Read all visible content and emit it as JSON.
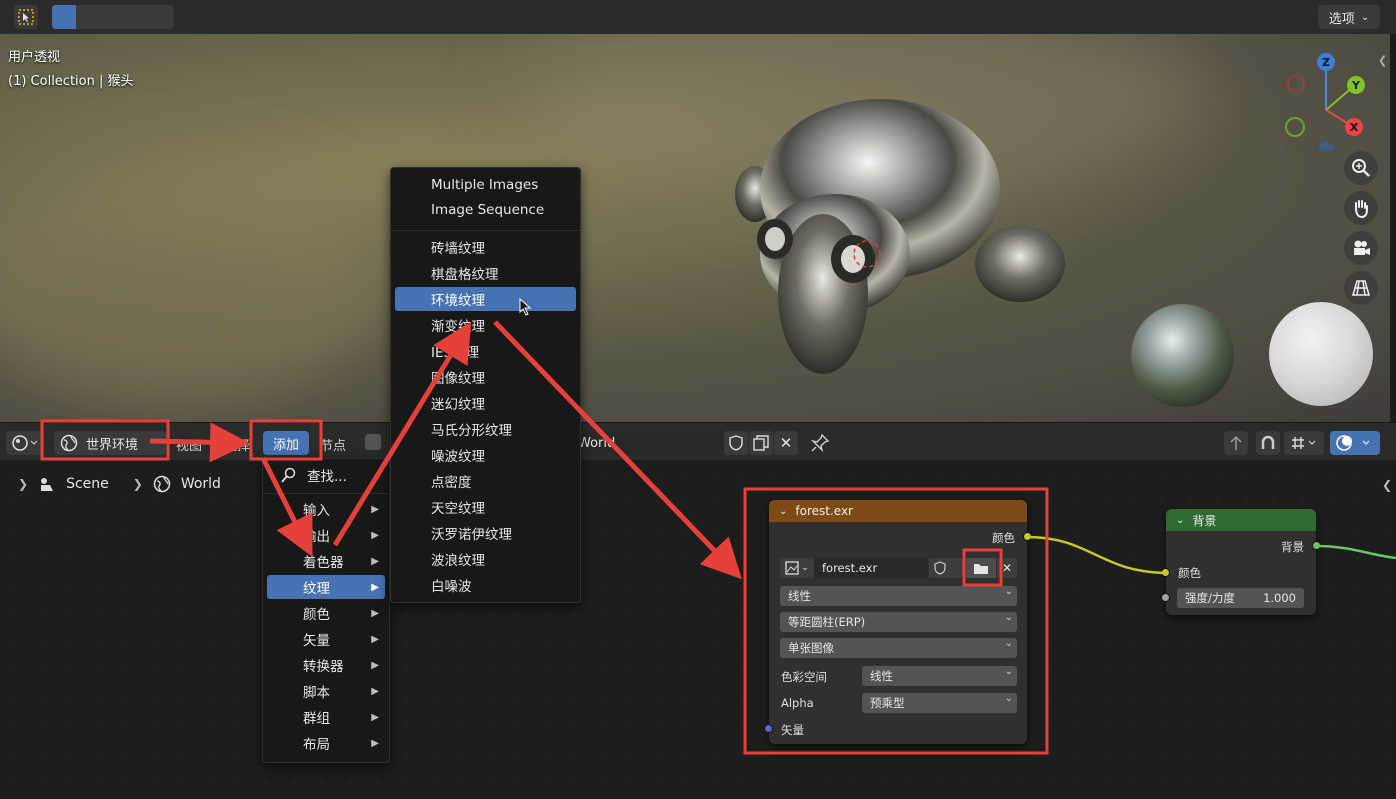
{
  "viewport": {
    "view_name": "用户透视",
    "collection_info": "(1) Collection | 猴头",
    "options_label": "选项",
    "gizmo_axes": {
      "z": "Z",
      "y": "Y",
      "x": "X"
    }
  },
  "node_header": {
    "world_type": "世界环境",
    "view_menu": "视图",
    "select_menu": "选择",
    "add_menu": "添加",
    "node_menu": "节点",
    "world_name": "World"
  },
  "breadcrumb": {
    "scene": "Scene",
    "world": "World"
  },
  "add_menu": {
    "search": "查找...",
    "items": [
      {
        "label": "输入",
        "has_submenu": true
      },
      {
        "label": "输出",
        "has_submenu": true
      },
      {
        "label": "着色器",
        "has_submenu": true
      },
      {
        "label": "纹理",
        "has_submenu": true,
        "active": true
      },
      {
        "label": "颜色",
        "has_submenu": true
      },
      {
        "label": "矢量",
        "has_submenu": true
      },
      {
        "label": "转换器",
        "has_submenu": true
      },
      {
        "label": "脚本",
        "has_submenu": true
      },
      {
        "label": "群组",
        "has_submenu": true
      },
      {
        "label": "布局",
        "has_submenu": true
      }
    ]
  },
  "texture_menu": {
    "top_items": [
      "Multiple Images",
      "Image Sequence"
    ],
    "items": [
      {
        "label": "砖墙纹理"
      },
      {
        "label": "棋盘格纹理"
      },
      {
        "label": "环境纹理",
        "active": true
      },
      {
        "label": "渐变纹理"
      },
      {
        "label": "IES纹理"
      },
      {
        "label": "图像纹理"
      },
      {
        "label": "迷幻纹理"
      },
      {
        "label": "马氏分形纹理"
      },
      {
        "label": "噪波纹理"
      },
      {
        "label": "点密度"
      },
      {
        "label": "天空纹理"
      },
      {
        "label": "沃罗诺伊纹理"
      },
      {
        "label": "波浪纹理"
      },
      {
        "label": "白噪波"
      }
    ]
  },
  "env_node": {
    "title": "forest.exr",
    "color_output": "颜色",
    "image_name": "forest.exr",
    "interpolation": "线性",
    "projection": "等距圆柱(ERP)",
    "source": "单张图像",
    "colorspace_label": "色彩空间",
    "colorspace_value": "线性",
    "alpha_label": "Alpha",
    "alpha_value": "预乘型",
    "vector_input": "矢量"
  },
  "bg_node": {
    "title": "背景",
    "output": "背景",
    "color_input": "颜色",
    "strength_label": "强度/力度",
    "strength_value": "1.000"
  },
  "colors": {
    "accent": "#4772b3",
    "highlight": "#e5403a",
    "env_node_header": "#7e4a15",
    "bg_node_header": "#2f6b2f",
    "socket_color": "#c7c729",
    "socket_vector": "#6363c7",
    "socket_gray": "#a1a1a1",
    "socket_shader": "#63c763"
  }
}
